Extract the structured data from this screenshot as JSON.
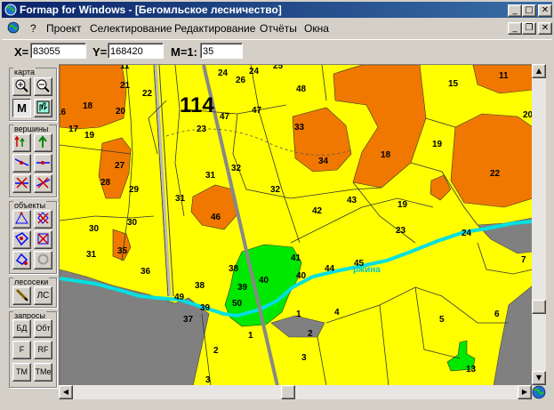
{
  "window": {
    "title": "Formap for Windows - [Бегомльское лесничество]",
    "controls": {
      "minimize": "_",
      "maximize": "□",
      "close": "✕",
      "restore": "❐"
    }
  },
  "menu": {
    "help_marker": "?",
    "items": [
      {
        "label": "Проект"
      },
      {
        "label": "Селектирование"
      },
      {
        "label": "Редактирование"
      },
      {
        "label": "Отчёты"
      },
      {
        "label": "Окна"
      }
    ]
  },
  "coords": {
    "x_label": "X=",
    "x_value": "83055",
    "y_label": "Y=",
    "y_value": "168420",
    "m_label": "M=1:",
    "m_value": "35"
  },
  "toolbox": {
    "groups": {
      "map": "карта",
      "vertices": "вершины",
      "objects": "объекты",
      "plots": "лесосеки",
      "queries": "запросы"
    },
    "buttons": {
      "m": "M",
      "ls": "ЛС",
      "bd": "БД",
      "obt": "Обт",
      "f": "F",
      "rf": "RF",
      "tm": "TM",
      "tme": "TMe"
    }
  },
  "map": {
    "quarter_number": "114",
    "river_name": "ржина",
    "colors": {
      "yellow": "#ffff00",
      "orange": "#f07800",
      "green": "#00e800",
      "gray": "#808080",
      "river": "#00e0e0",
      "road": "#888888"
    },
    "labels": [
      "11",
      "21",
      "22",
      "24",
      "26",
      "24",
      "25",
      "48",
      "15",
      "11",
      "16",
      "18",
      "20",
      "47",
      "47",
      "20",
      "17",
      "19",
      "23",
      "33",
      "19",
      "27",
      "31",
      "32",
      "34",
      "18",
      "22",
      "28",
      "29",
      "31",
      "32",
      "43",
      "19",
      "46",
      "42",
      "30",
      "23",
      "24",
      "30",
      "35",
      "31",
      "41",
      "45",
      "7",
      "36",
      "38",
      "44",
      "40",
      "40",
      "38",
      "39",
      "49",
      "39",
      "50",
      "1",
      "4",
      "6",
      "5",
      "37",
      "1",
      "2",
      "2",
      "3",
      "13",
      "3"
    ]
  },
  "scroll": {
    "up": "▲",
    "down": "▼",
    "left": "◀",
    "right": "▶"
  }
}
